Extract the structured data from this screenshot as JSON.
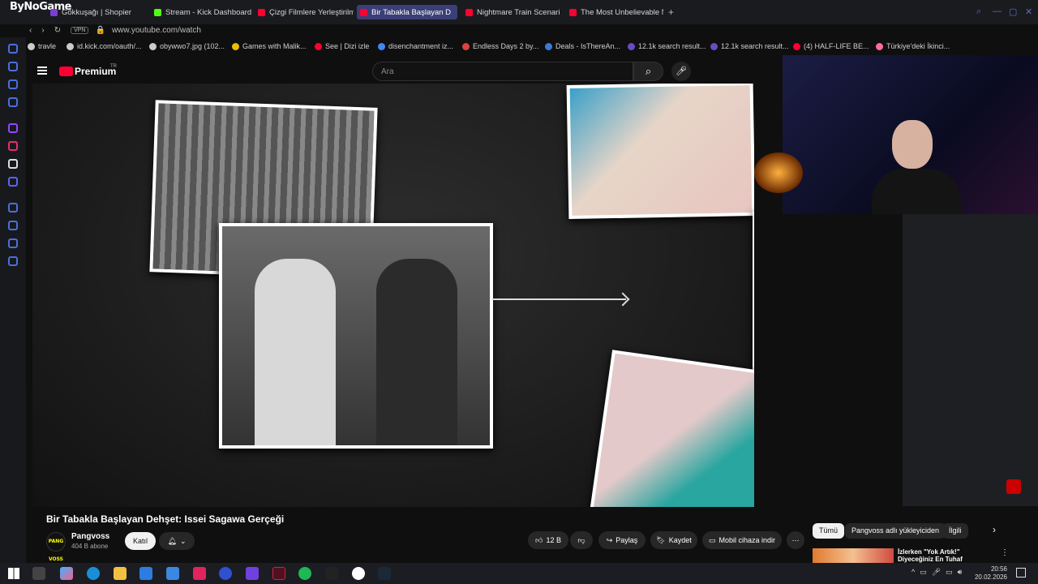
{
  "browser": {
    "brand": "ByNoGame",
    "url": "www.youtube.com/watch",
    "vpn": "VPN",
    "tabs": [
      {
        "label": "Gökkuşağı | Shopier",
        "color": "#7a3fd0"
      },
      {
        "label": "Stream - Kick Dashboard",
        "color": "#53fc18"
      },
      {
        "label": "Çizgi Filmlere Yerleştirilm",
        "color": "#ff0033"
      },
      {
        "label": "Bir Tabakla Başlayan D",
        "color": "#ff0033"
      },
      {
        "label": "Nightmare Train Scenario",
        "color": "#ff0033"
      },
      {
        "label": "The Most Unbelievable Na",
        "color": "#ff0033"
      }
    ],
    "bookmarks": [
      "travle",
      "id.kick.com/oauth/...",
      "obywwo7.jpg (102...",
      "Games with Malik...",
      "See | Dizi izle",
      "disenchantment iz...",
      "Endless Days 2 by...",
      "Deals - IsThereAn...",
      "12.1k search result...",
      "12.1k search result...",
      "(4) HALF-LIFE BE...",
      "Türkiye'deki İkinci..."
    ]
  },
  "youtube": {
    "brand": "Premium",
    "region": "TR",
    "search_placeholder": "Ara",
    "video_title": "Bir Tabakla Başlayan Dehşet: Issei Sagawa Gerçeği",
    "channel": "Pangvoss",
    "channel_avatar": "PANG VOSS",
    "subscribers": "404 B abone",
    "join": "Katıl",
    "likes": "12 B",
    "share": "Paylaş",
    "save": "Kaydet",
    "download": "Mobil cihaza indir",
    "chips": [
      "Tümü",
      "Pangvoss adlı yükleyiciden",
      "İlgili"
    ],
    "rec_title": "İzlerken \"Yok Artık!\" Diyeceğiniz En Tuhaf Bağımlılıklar Serisi |"
  },
  "taskbar": {
    "time": "20:56",
    "date": "20.02.2026"
  }
}
